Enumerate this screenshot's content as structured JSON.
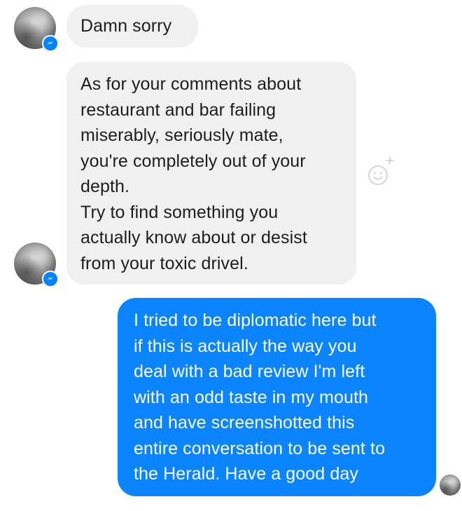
{
  "conversation": {
    "messages": [
      {
        "sender": "them",
        "text": "Damn sorry"
      },
      {
        "sender": "them",
        "text": "As for your comments about\nrestaurant and bar failing\nmiserably, seriously mate,\nyou're completely out of your\ndepth.\nTry to find something you\nactually know about or desist\nfrom your toxic drivel."
      },
      {
        "sender": "me",
        "text": "I tried to be diplomatic here but\nif this is actually the way you\ndeal with a bad review I'm left\nwith an odd taste in my mouth\nand have screenshotted this\nentire conversation to be sent to\nthe Herald. Have a good day"
      }
    ]
  },
  "icons": {
    "badge": "messenger-icon",
    "reaction": "add-reaction-icon"
  },
  "colors": {
    "incoming_bubble": "#f1f0f0",
    "outgoing_bubble": "#0a84ff",
    "badge": "#0084ff"
  }
}
